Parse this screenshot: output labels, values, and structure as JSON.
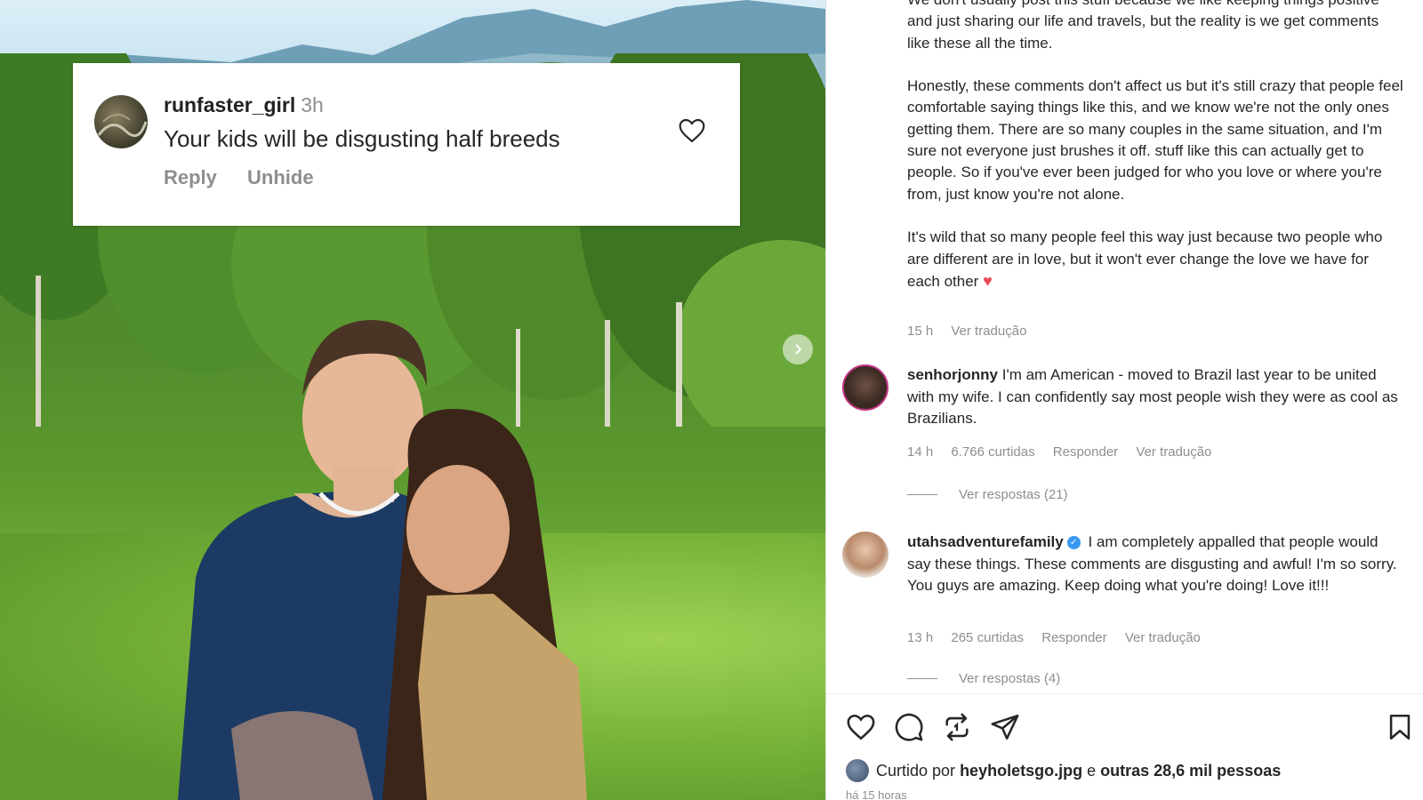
{
  "overlay_comment": {
    "username": "runfaster_girl",
    "time": "3h",
    "text": "Your kids will be disgusting half breeds",
    "reply_label": "Reply",
    "unhide_label": "Unhide"
  },
  "caption": {
    "paragraphs": [
      "We don't usually post this stuff because we like keeping things positive and just sharing our life and travels, but the reality is we get comments like these all the time.",
      "Honestly, these comments don't affect us but it's still crazy that people feel comfortable saying things like this, and we know we're not the only ones getting them. There are so many couples in the same situation, and I'm sure not everyone just brushes it off. stuff like this can actually get to people. So if you've ever been judged for who you love or where you're from, just know you're not alone.",
      "It's wild that so many people feel this way just because two people who are different are in love, but it won't ever change the love we have for each other"
    ],
    "time": "15 h",
    "translate": "Ver tradução"
  },
  "comments": [
    {
      "username": "senhorjonny",
      "verified": false,
      "text": "I'm am American - moved to Brazil last year to be united with my wife. I can confidently say most people wish they were as cool as Brazilians.",
      "time": "14 h",
      "likes": "6.766 curtidas",
      "reply": "Responder",
      "translate": "Ver tradução",
      "view_replies": "Ver respostas (21)"
    },
    {
      "username": "utahsadventurefamily",
      "verified": true,
      "text": "I am completely appalled that people would say these things. These comments are disgusting and awful! I'm so sorry. You guys are amazing. Keep doing what you're doing! Love it!!!",
      "time": "13 h",
      "likes": "265 curtidas",
      "reply": "Responder",
      "translate": "Ver tradução",
      "view_replies": "Ver respostas (4)"
    }
  ],
  "liked_by": {
    "prefix": "Curtido por",
    "user": "heyholetsgo.jpg",
    "joiner": "e",
    "others": "outras 28,6 mil pessoas"
  },
  "posted_ago": "há 15 horas",
  "colors": {
    "accent_blue": "#3897f0",
    "heart_red": "#ed4956",
    "muted": "#8e8e8e"
  }
}
